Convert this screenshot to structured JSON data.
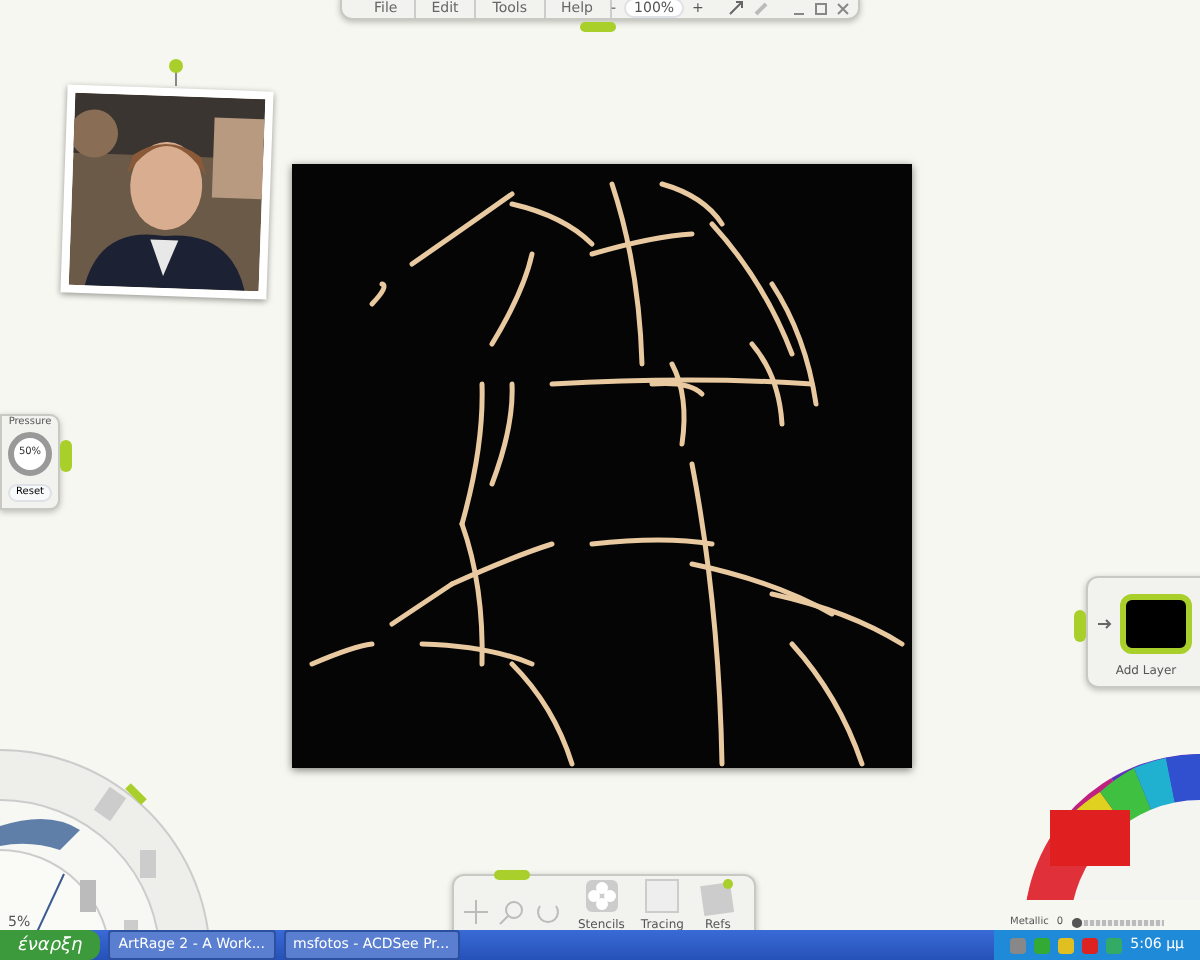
{
  "menu": [
    {
      "label": "File"
    },
    {
      "label": "Edit"
    },
    {
      "label": "Tools"
    },
    {
      "label": "Help"
    }
  ],
  "zoom": {
    "minus": "-",
    "value": "100%",
    "plus": "+"
  },
  "pressure": {
    "label": "Pressure",
    "value": "50%",
    "reset": "Reset"
  },
  "layers": {
    "add": "Add Layer"
  },
  "tool_picker": {
    "size": "5%"
  },
  "bottom_tray": [
    {
      "label": "Stencils",
      "kind": "stencils"
    },
    {
      "label": "Tracing",
      "kind": "tracing"
    },
    {
      "label": "Refs",
      "kind": "refs"
    }
  ],
  "color_picker": {
    "metallic": {
      "label": "Metallic",
      "value": "0",
      "level": 0
    }
  },
  "taskbar": {
    "start": "έναρξη",
    "tasks": [
      {
        "label": "ArtRage 2 - A Work..."
      },
      {
        "label": "msfotos - ACDSee Pr..."
      }
    ],
    "clock": "5:06 μμ"
  }
}
